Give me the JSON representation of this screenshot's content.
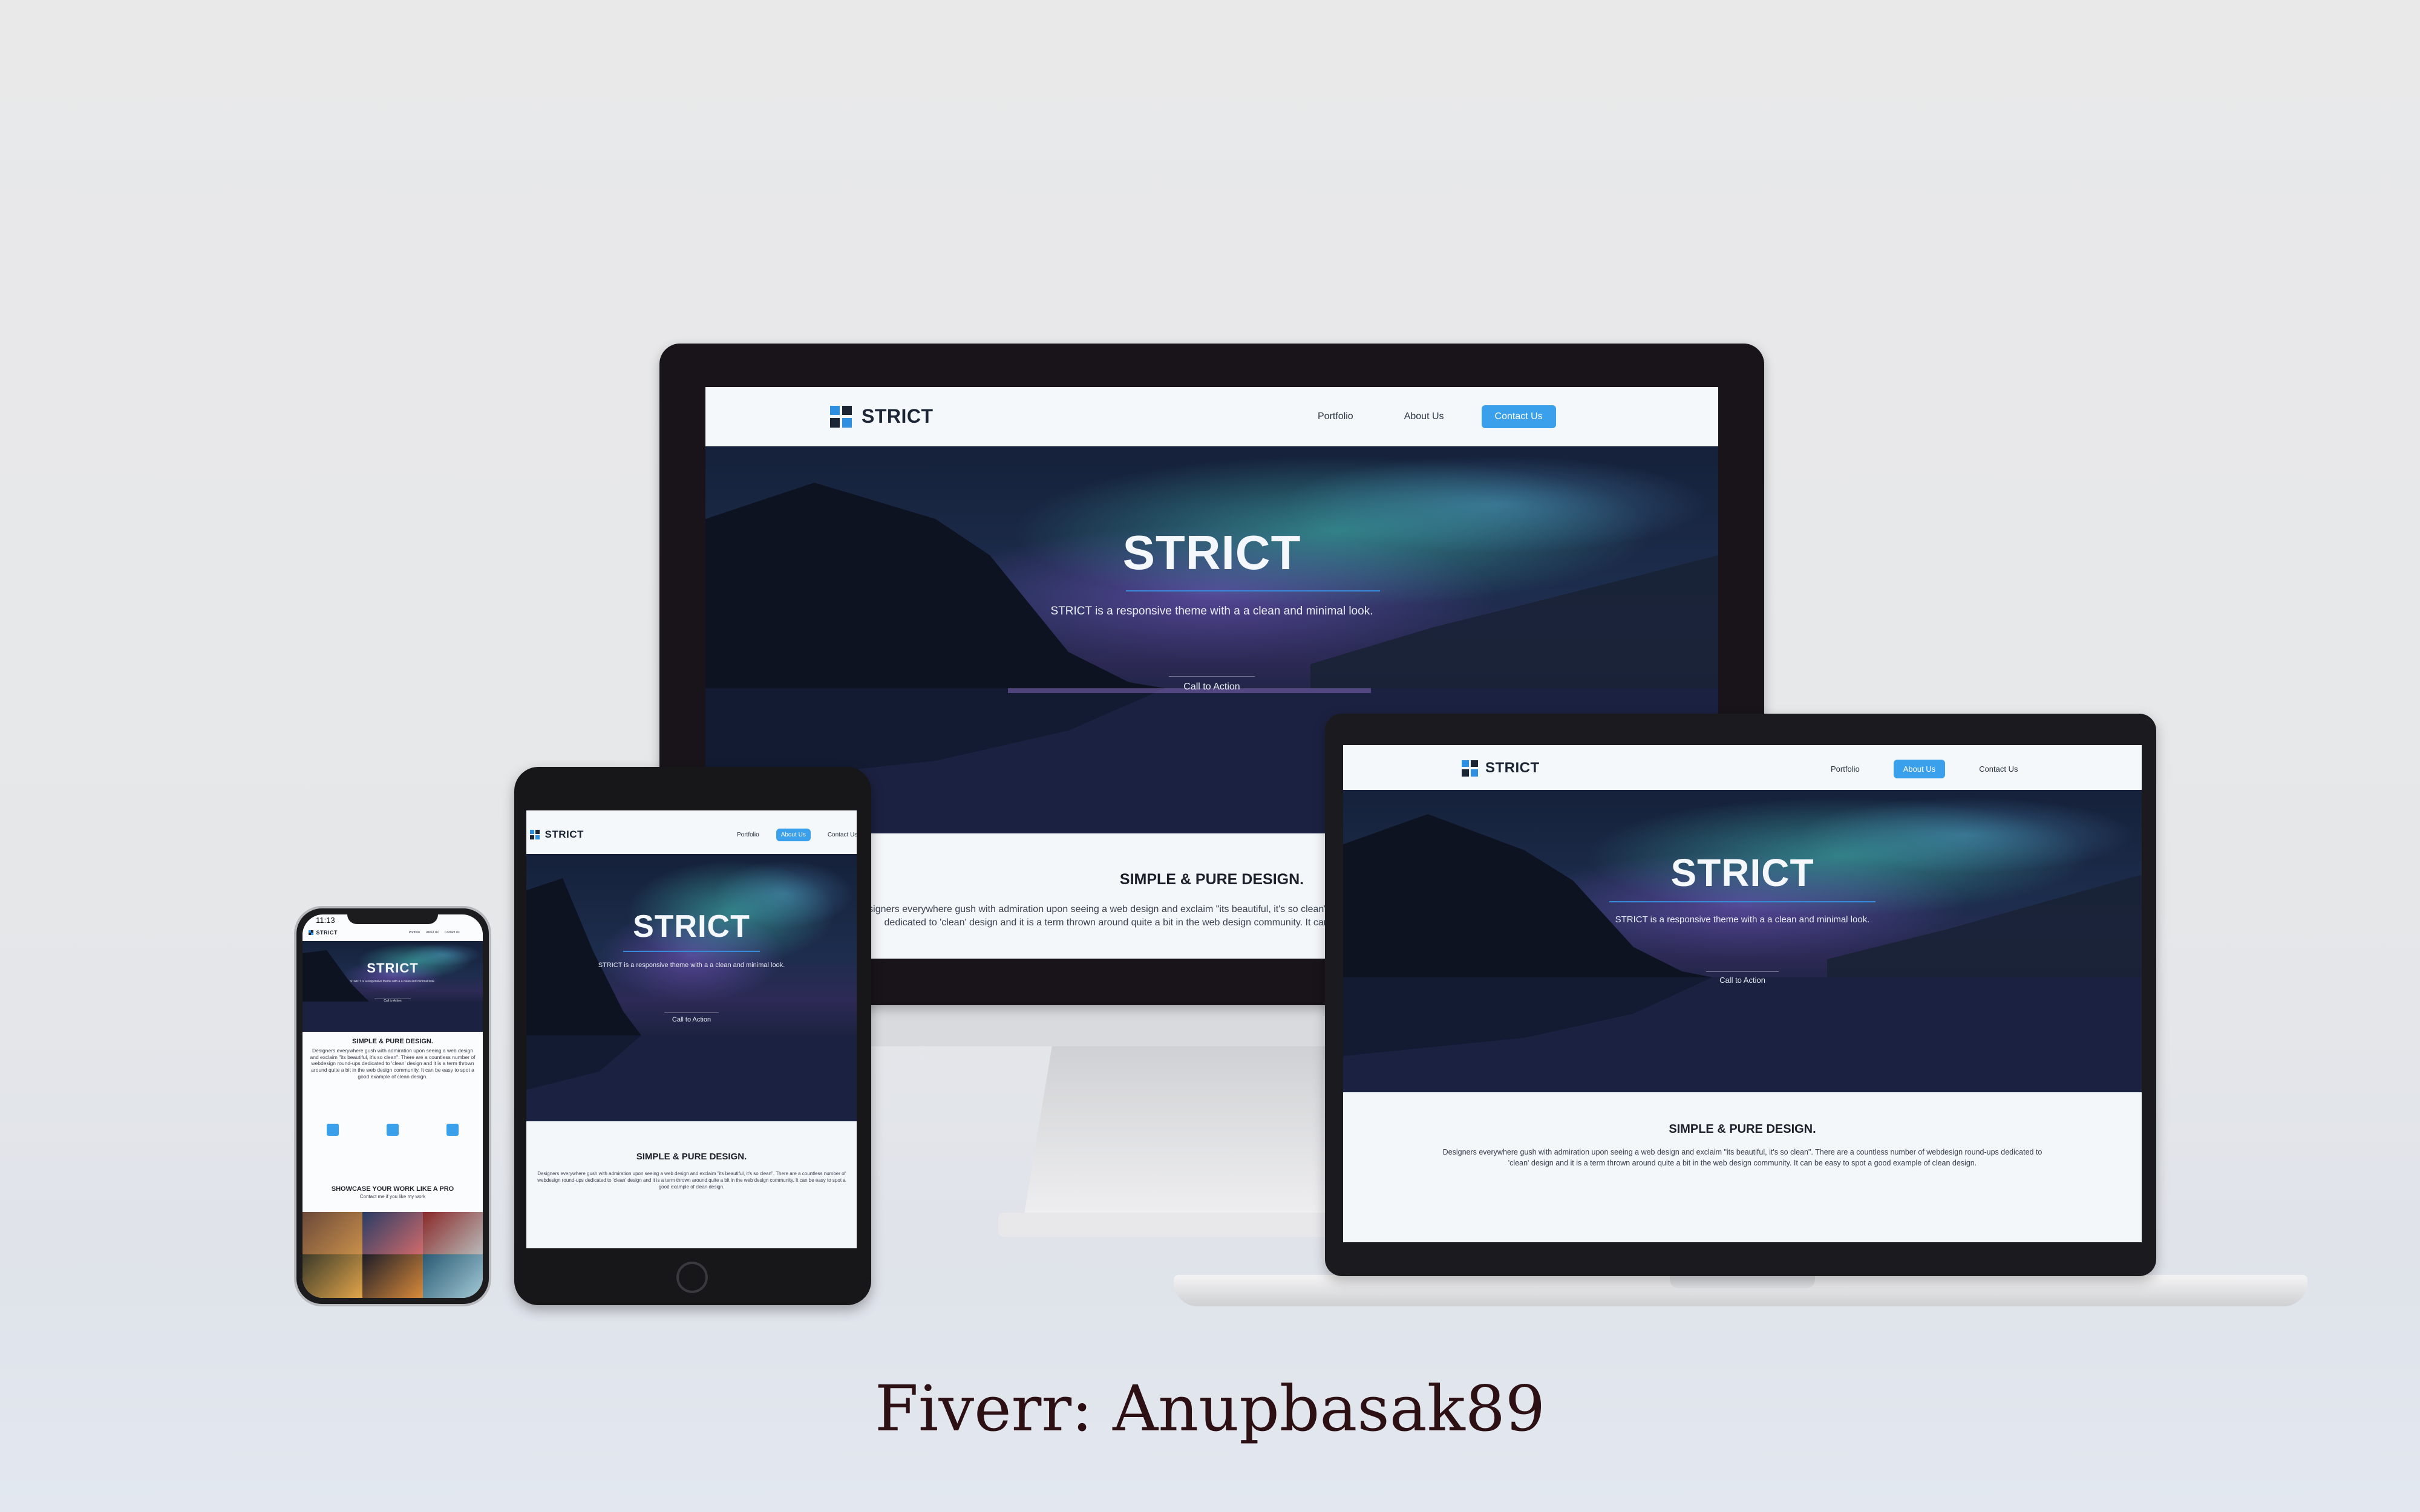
{
  "site": {
    "brand": "STRICT",
    "nav": [
      "Portfolio",
      "About Us",
      "Contact Us"
    ],
    "hero_title": "STRICT",
    "hero_tagline": "STRICT is a responsive theme with a a clean and minimal look.",
    "cta_label": "Call to Action",
    "section_title": "SIMPLE & PURE DESIGN.",
    "section_text": "Designers everywhere gush with admiration upon seeing a web design and exclaim \"its beautiful, it's so clean\". There are a countless number of webdesign round-ups dedicated to 'clean' design and it is a term thrown around quite a bit in the web design community. It can be easy to spot a good example of clean design.",
    "portfolio_title": "SHOWCASE YOUR WORK LIKE A PRO",
    "portfolio_sub": "Contact me if you like my work"
  },
  "monitor": {
    "active_nav": "Contact Us"
  },
  "laptop": {
    "active_nav": "About Us"
  },
  "tablet": {
    "active_nav": "About Us"
  },
  "phone": {
    "status_time": "11:13"
  },
  "footer": {
    "credit": "Fiverr: Anupbasak89"
  },
  "colors": {
    "accent": "#3aa0ec",
    "brand_dark": "#1c2533",
    "credit": "#2d1013"
  }
}
